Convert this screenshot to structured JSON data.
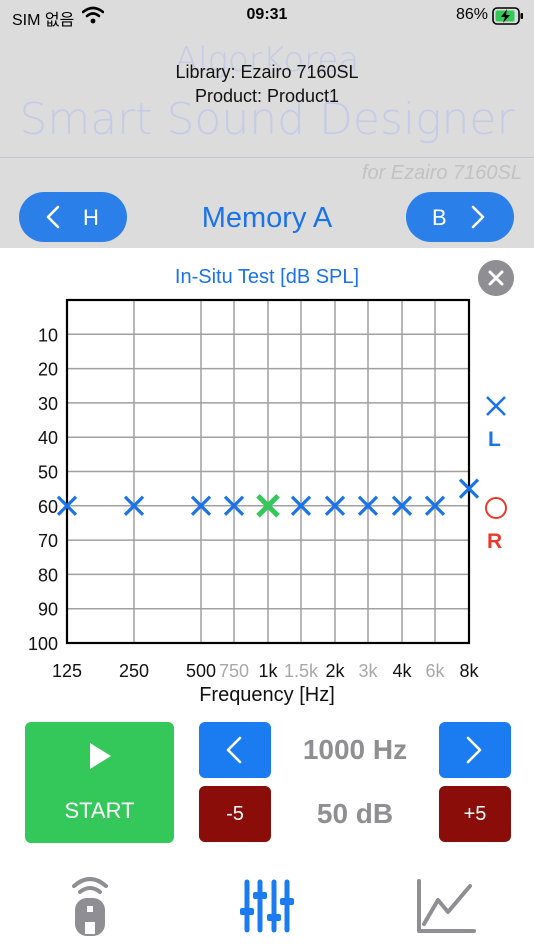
{
  "status_bar": {
    "carrier": "SIM 없음",
    "time": "09:31",
    "battery": "86%"
  },
  "background": {
    "brand": "AlgorKorea",
    "app_name": "Smart Sound Designer",
    "library": "Library: Ezairo 7160SL",
    "product": "Product: Product1",
    "for_device": "for Ezairo 7160SL",
    "left_button": "H",
    "memory": "Memory A",
    "right_button": "B"
  },
  "panel": {
    "title": "In-Situ Test [dB SPL]",
    "xlabel": "Frequency [Hz]",
    "legend_left": "L",
    "legend_right": "R"
  },
  "chart_data": {
    "type": "scatter",
    "title": "In-Situ Test [dB SPL]",
    "xlabel": "Frequency [Hz]",
    "ylabel": "",
    "y_ticks": [
      "10",
      "20",
      "30",
      "40",
      "50",
      "60",
      "70",
      "80",
      "90",
      "100"
    ],
    "ylim": [
      0,
      100
    ],
    "y_inverted": true,
    "x_ticks": [
      {
        "label": "125",
        "muted": false
      },
      {
        "label": "250",
        "muted": false
      },
      {
        "label": "500",
        "muted": false
      },
      {
        "label": "750",
        "muted": true
      },
      {
        "label": "1k",
        "muted": false
      },
      {
        "label": "1.5k",
        "muted": true
      },
      {
        "label": "2k",
        "muted": false
      },
      {
        "label": "3k",
        "muted": true
      },
      {
        "label": "4k",
        "muted": false
      },
      {
        "label": "6k",
        "muted": true
      },
      {
        "label": "8k",
        "muted": false
      }
    ],
    "grid": true,
    "series": [
      {
        "name": "L",
        "color": "#1a73e8",
        "marker": "x",
        "points": [
          {
            "x": "125",
            "y": 60
          },
          {
            "x": "250",
            "y": 60
          },
          {
            "x": "500",
            "y": 60
          },
          {
            "x": "750",
            "y": 60
          },
          {
            "x": "1.5k",
            "y": 60
          },
          {
            "x": "2k",
            "y": 60
          },
          {
            "x": "3k",
            "y": 60
          },
          {
            "x": "4k",
            "y": 60
          },
          {
            "x": "6k",
            "y": 60
          },
          {
            "x": "8k",
            "y": 55
          }
        ]
      },
      {
        "name": "current",
        "color": "#34c759",
        "marker": "x",
        "points": [
          {
            "x": "1k",
            "y": 60
          }
        ]
      }
    ]
  },
  "controls": {
    "start_label": "START",
    "frequency": "1000 Hz",
    "level": "50 dB",
    "minus_label": "-5",
    "plus_label": "+5"
  },
  "colors": {
    "accent": "#1a73e8",
    "start": "#34c759",
    "step": "#8b0d0a",
    "right_ear": "#e83a2b"
  },
  "tab_bar": {
    "items": [
      "remote-icon",
      "equalizer-icon",
      "graph-icon"
    ],
    "active": "equalizer-icon"
  }
}
